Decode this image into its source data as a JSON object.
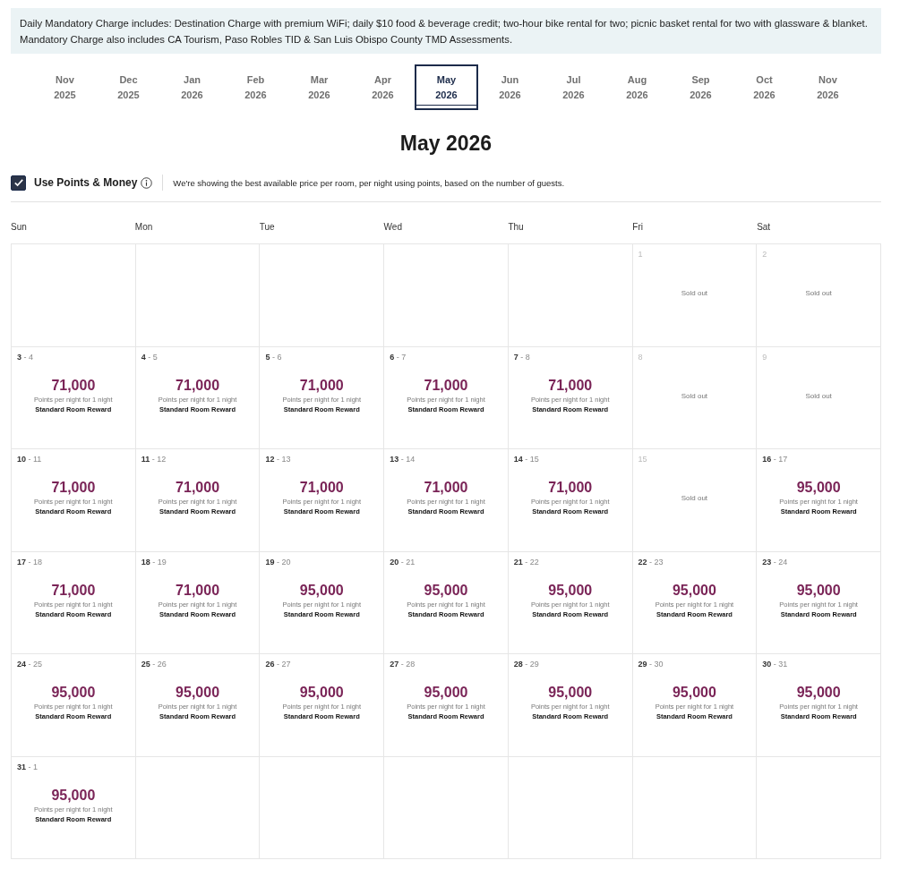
{
  "notice": "Daily Mandatory Charge includes: Destination Charge with premium WiFi; daily $10 food & beverage credit; two-hour bike rental for two; picnic basket rental for two with glassware & blanket. Mandatory Charge also includes CA Tourism, Paso Robles TID & San Luis Obispo County TMD Assessments.",
  "months": [
    {
      "month": "Nov",
      "year": "2025",
      "selected": false
    },
    {
      "month": "Dec",
      "year": "2025",
      "selected": false
    },
    {
      "month": "Jan",
      "year": "2026",
      "selected": false
    },
    {
      "month": "Feb",
      "year": "2026",
      "selected": false
    },
    {
      "month": "Mar",
      "year": "2026",
      "selected": false
    },
    {
      "month": "Apr",
      "year": "2026",
      "selected": false
    },
    {
      "month": "May",
      "year": "2026",
      "selected": true
    },
    {
      "month": "Jun",
      "year": "2026",
      "selected": false
    },
    {
      "month": "Jul",
      "year": "2026",
      "selected": false
    },
    {
      "month": "Aug",
      "year": "2026",
      "selected": false
    },
    {
      "month": "Sep",
      "year": "2026",
      "selected": false
    },
    {
      "month": "Oct",
      "year": "2026",
      "selected": false
    },
    {
      "month": "Nov",
      "year": "2026",
      "selected": false
    }
  ],
  "title": "May 2026",
  "points_toggle": {
    "label": "Use Points & Money",
    "checked": true,
    "note": "We're showing the best available price per room, per night using points, based on the number of guests."
  },
  "weekdays": [
    "Sun",
    "Mon",
    "Tue",
    "Wed",
    "Thu",
    "Fri",
    "Sat"
  ],
  "weeks": [
    [
      {
        "kind": "empty"
      },
      {
        "kind": "empty"
      },
      {
        "kind": "empty"
      },
      {
        "kind": "empty"
      },
      {
        "kind": "empty"
      },
      {
        "kind": "soldout",
        "date": "1",
        "status": "Sold out"
      },
      {
        "kind": "soldout",
        "date": "2",
        "status": "Sold out"
      }
    ],
    [
      {
        "kind": "available",
        "dates": "**3** - 4",
        "points": "71,000",
        "caption": "Points per night for 1 night",
        "reward": "Standard Room Reward"
      },
      {
        "kind": "available",
        "dates": "**4** - 5",
        "points": "71,000",
        "caption": "Points per night for 1 night",
        "reward": "Standard Room Reward"
      },
      {
        "kind": "available",
        "dates": "**5** - 6",
        "points": "71,000",
        "caption": "Points per night for 1 night",
        "reward": "Standard Room Reward"
      },
      {
        "kind": "available",
        "dates": "**6** - 7",
        "points": "71,000",
        "caption": "Points per night for 1 night",
        "reward": "Standard Room Reward"
      },
      {
        "kind": "available",
        "dates": "**7** - 8",
        "points": "71,000",
        "caption": "Points per night for 1 night",
        "reward": "Standard Room Reward"
      },
      {
        "kind": "soldout",
        "date": "8",
        "status": "Sold out"
      },
      {
        "kind": "soldout",
        "date": "9",
        "status": "Sold out"
      }
    ],
    [
      {
        "kind": "available",
        "dates": "**10** - 11",
        "points": "71,000",
        "caption": "Points per night for 1 night",
        "reward": "Standard Room Reward"
      },
      {
        "kind": "available",
        "dates": "**11** - 12",
        "points": "71,000",
        "caption": "Points per night for 1 night",
        "reward": "Standard Room Reward"
      },
      {
        "kind": "available",
        "dates": "**12** - 13",
        "points": "71,000",
        "caption": "Points per night for 1 night",
        "reward": "Standard Room Reward"
      },
      {
        "kind": "available",
        "dates": "**13** - 14",
        "points": "71,000",
        "caption": "Points per night for 1 night",
        "reward": "Standard Room Reward"
      },
      {
        "kind": "available",
        "dates": "**14** - 15",
        "points": "71,000",
        "caption": "Points per night for 1 night",
        "reward": "Standard Room Reward"
      },
      {
        "kind": "soldout",
        "date": "15",
        "status": "Sold out"
      },
      {
        "kind": "available",
        "dates": "**16** - 17",
        "points": "95,000",
        "caption": "Points per night for 1 night",
        "reward": "Standard Room Reward"
      }
    ],
    [
      {
        "kind": "available",
        "dates": "**17** - 18",
        "points": "71,000",
        "caption": "Points per night for 1 night",
        "reward": "Standard Room Reward"
      },
      {
        "kind": "available",
        "dates": "**18** - 19",
        "points": "71,000",
        "caption": "Points per night for 1 night",
        "reward": "Standard Room Reward"
      },
      {
        "kind": "available",
        "dates": "**19** - 20",
        "points": "95,000",
        "caption": "Points per night for 1 night",
        "reward": "Standard Room Reward"
      },
      {
        "kind": "available",
        "dates": "**20** - 21",
        "points": "95,000",
        "caption": "Points per night for 1 night",
        "reward": "Standard Room Reward"
      },
      {
        "kind": "available",
        "dates": "**21** - 22",
        "points": "95,000",
        "caption": "Points per night for 1 night",
        "reward": "Standard Room Reward"
      },
      {
        "kind": "available",
        "dates": "**22** - 23",
        "points": "95,000",
        "caption": "Points per night for 1 night",
        "reward": "Standard Room Reward"
      },
      {
        "kind": "available",
        "dates": "**23** - 24",
        "points": "95,000",
        "caption": "Points per night for 1 night",
        "reward": "Standard Room Reward"
      }
    ],
    [
      {
        "kind": "available",
        "dates": "**24** - 25",
        "points": "95,000",
        "caption": "Points per night for 1 night",
        "reward": "Standard Room Reward"
      },
      {
        "kind": "available",
        "dates": "**25** - 26",
        "points": "95,000",
        "caption": "Points per night for 1 night",
        "reward": "Standard Room Reward"
      },
      {
        "kind": "available",
        "dates": "**26** - 27",
        "points": "95,000",
        "caption": "Points per night for 1 night",
        "reward": "Standard Room Reward"
      },
      {
        "kind": "available",
        "dates": "**27** - 28",
        "points": "95,000",
        "caption": "Points per night for 1 night",
        "reward": "Standard Room Reward"
      },
      {
        "kind": "available",
        "dates": "**28** - 29",
        "points": "95,000",
        "caption": "Points per night for 1 night",
        "reward": "Standard Room Reward"
      },
      {
        "kind": "available",
        "dates": "**29** - 30",
        "points": "95,000",
        "caption": "Points per night for 1 night",
        "reward": "Standard Room Reward"
      },
      {
        "kind": "available",
        "dates": "**30** - 31",
        "points": "95,000",
        "caption": "Points per night for 1 night",
        "reward": "Standard Room Reward"
      }
    ],
    [
      {
        "kind": "available",
        "dates": "**31** - 1",
        "points": "95,000",
        "caption": "Points per night for 1 night",
        "reward": "Standard Room Reward"
      },
      {
        "kind": "empty"
      },
      {
        "kind": "empty"
      },
      {
        "kind": "empty"
      },
      {
        "kind": "empty"
      },
      {
        "kind": "empty"
      },
      {
        "kind": "empty"
      }
    ]
  ]
}
